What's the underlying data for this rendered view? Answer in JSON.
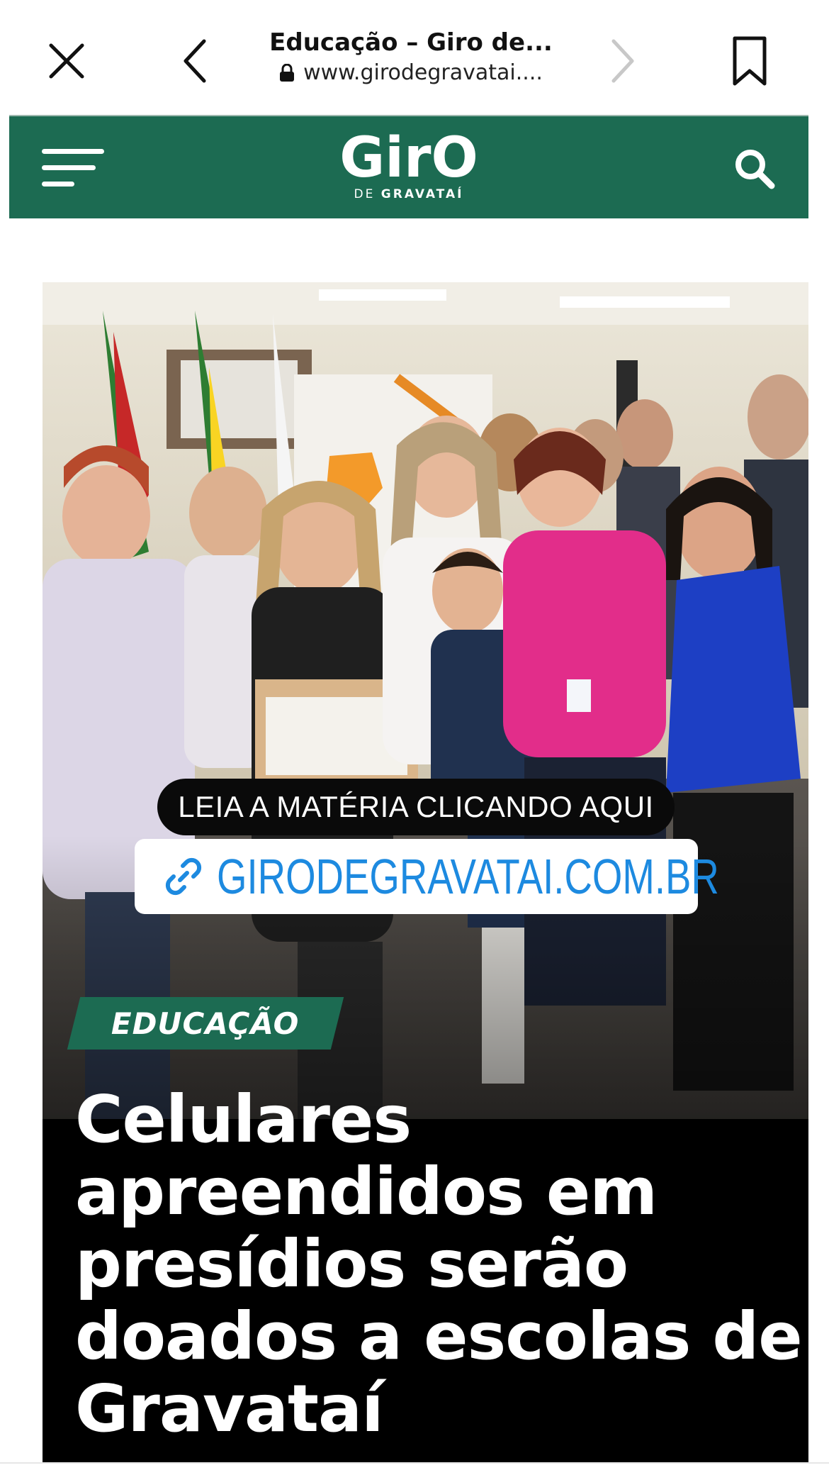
{
  "browser": {
    "title": "Educação – Giro de...",
    "url": "www.girodegravatai....",
    "icons": {
      "close": "close-icon",
      "back": "chevron-left-icon",
      "forward": "chevron-right-icon",
      "bookmark": "bookmark-icon",
      "lock": "lock-icon"
    }
  },
  "site": {
    "logo_main": "GirO",
    "logo_sub_prefix": "DE",
    "logo_sub_name": "GRAVATAÍ",
    "brand_color": "#1c6b52",
    "icons": {
      "menu": "hamburger-menu-icon",
      "search": "search-icon"
    }
  },
  "hero": {
    "cta_label": "LEIA A MATÉRIA CLICANDO AQUI",
    "cta_link": "GIRODEGRAVATAI.COM.BR",
    "cta_link_color": "#1d8ae0",
    "category": "EDUCAÇÃO",
    "headline": "Celulares apreendidos em presídios serão doados a escolas de Gravataí"
  }
}
